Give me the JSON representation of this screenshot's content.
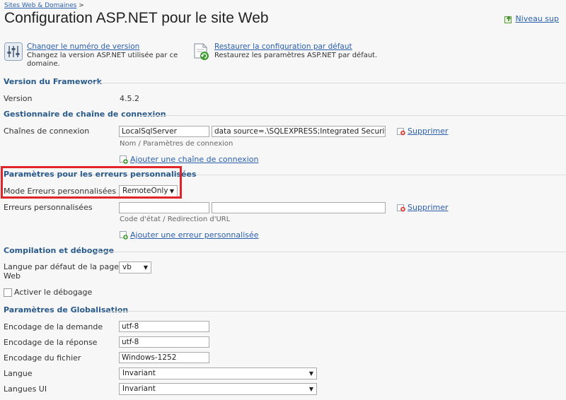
{
  "breadcrumb": "Sites Web & Domaines",
  "breadcrumb_sep": ">",
  "title": "Configuration ASP.NET pour le site Web",
  "up_link": "Niveau sup",
  "actions": [
    {
      "title": "Changer le numéro de version",
      "desc": "Changez la version ASP.NET utilisée par ce domaine.",
      "icon": "settings-sliders-icon"
    },
    {
      "title": "Restaurer la configuration par défaut",
      "desc": "Restaurez les paramètres ASP.NET par défaut.",
      "icon": "restore-document-icon"
    }
  ],
  "framework": {
    "section_title": "Version du Framework",
    "version_label": "Version",
    "version_value": "4.5.2"
  },
  "connection": {
    "section_title": "Gestionnaire de chaîne de connexion",
    "label": "Chaînes de connexion",
    "name_value": "LocalSqlServer",
    "params_value": "data source=.\\SQLEXPRESS;Integrated Security=SSPI",
    "hint": "Nom / Paramètres de connexion",
    "delete_label": "Supprimer",
    "add_label": "Ajouter une chaîne de connexion"
  },
  "custom_errors": {
    "section_title": "Paramètres pour les erreurs personnalisées",
    "mode_label": "Mode Erreurs personnalisées",
    "mode_value": "RemoteOnly",
    "errors_label": "Erreurs personnalisées",
    "code_value": "",
    "redirect_value": "",
    "hint": "Code d'état / Redirection d'URL",
    "delete_label": "Supprimer",
    "add_label": "Ajouter une erreur personnalisée"
  },
  "compilation": {
    "section_title": "Compilation et débogage",
    "language_label_1": "Langue par défaut de la page",
    "language_label_2": "Web",
    "language_value": "vb",
    "debug_label": "Activer le débogage",
    "debug_checked": false
  },
  "globalization": {
    "section_title": "Paramètres de Globalisation",
    "request_label": "Encodage de la demande",
    "request_value": "utf-8",
    "response_label": "Encodage de la réponse",
    "response_value": "utf-8",
    "file_label": "Encodage du fichier",
    "file_value": "Windows-1252",
    "culture_label": "Langue",
    "culture_value": "Invariant",
    "ui_culture_label": "Langues UI",
    "ui_culture_value": "Invariant"
  },
  "colors": {
    "link": "#2a5fad",
    "section": "#2a5a8a",
    "highlight": "#e0252a",
    "background": "#f7f7f7"
  }
}
